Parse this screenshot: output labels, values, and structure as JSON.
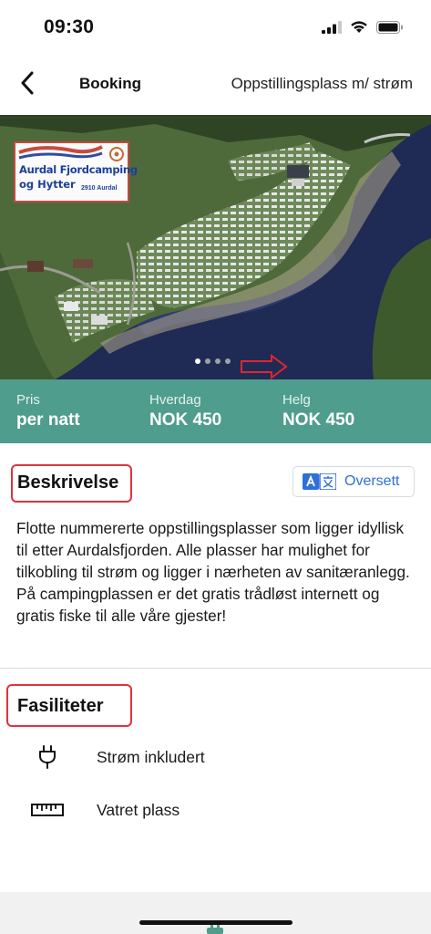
{
  "status_bar": {
    "time": "09:30"
  },
  "nav": {
    "title": "Booking",
    "subtitle": "Oppstillingsplass m/ strøm"
  },
  "hero": {
    "logo": {
      "line1": "Aurdal Fjordcamping",
      "line2": "og Hytter",
      "place": "2910 Aurdal"
    },
    "slides_total": 4,
    "active_slide": 1
  },
  "pricing": {
    "columns": [
      {
        "label": "Pris",
        "value": "per natt"
      },
      {
        "label": "Hverdag",
        "value": "NOK 450"
      },
      {
        "label": "Helg",
        "value": "NOK 450"
      }
    ]
  },
  "description": {
    "title": "Beskrivelse",
    "translate_label": "Oversett",
    "text": "Flotte nummererte oppstillingsplasser som ligger idyllisk til etter Aurdalsfjorden. Alle plasser har mulighet for tilkobling til strøm og ligger i nærheten av sanitæranlegg. På campingplassen er det gratis trådløst internett og gratis fiske til alle våre gjester!"
  },
  "facilities": {
    "title": "Fasiliteter",
    "items": [
      {
        "label": "Strøm inkludert",
        "icon": "power-plug-icon"
      },
      {
        "label": "Vatret plass",
        "icon": "ruler-icon"
      }
    ]
  },
  "colors": {
    "accent": "#4f9d8c",
    "link": "#2f6fd8",
    "highlight": "#e2313f"
  }
}
